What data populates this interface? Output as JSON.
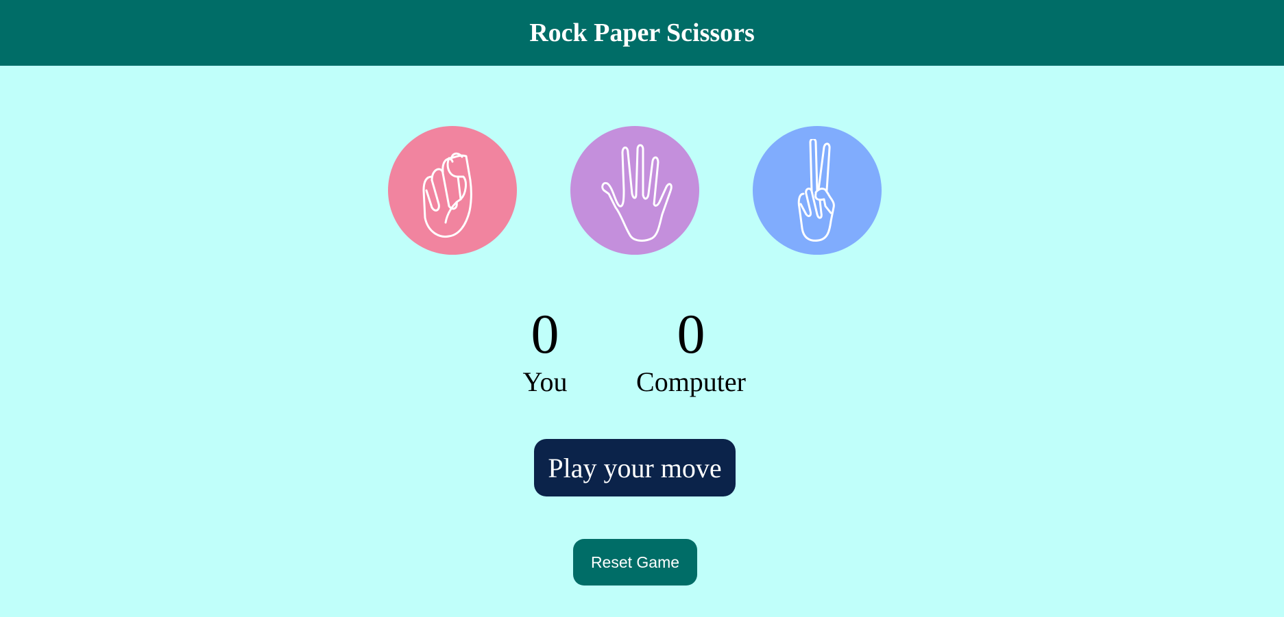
{
  "header": {
    "title": "Rock Paper Scissors"
  },
  "choices": [
    {
      "name": "Rock",
      "icon": "fist-icon",
      "color": "#f1849f"
    },
    {
      "name": "Paper",
      "icon": "open-hand-icon",
      "color": "#c48fdc"
    },
    {
      "name": "Scissors",
      "icon": "peace-hand-icon",
      "color": "#80acfd"
    }
  ],
  "scores": {
    "you": {
      "value": "0",
      "label": "You"
    },
    "computer": {
      "value": "0",
      "label": "Computer"
    }
  },
  "buttons": {
    "play": "Play your move",
    "reset": "Reset Game"
  },
  "colors": {
    "header": "#006d67",
    "background": "#c0fffa",
    "play_button": "#0b234a"
  }
}
